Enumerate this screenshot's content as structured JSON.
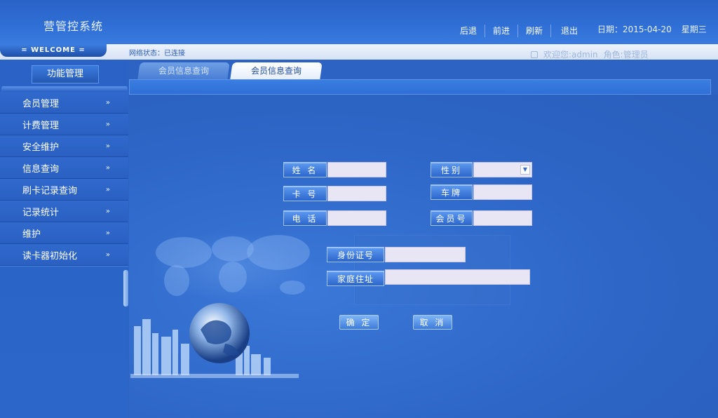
{
  "header": {
    "title": "营管控系统",
    "nav": {
      "back": "后退",
      "forward": "前进",
      "refresh": "刷新",
      "logout": "退出"
    },
    "date_label": "日期：2015-04-20",
    "weekday": "星期三"
  },
  "statusbar": {
    "welcome": "= WELCOME =",
    "network_status": "网络状态：已连接",
    "user": "欢迎您:admin",
    "role": "角色:管理员"
  },
  "sidebar": {
    "heading": "功能管理",
    "items": [
      {
        "label": "会员管理"
      },
      {
        "label": "计费管理"
      },
      {
        "label": "安全维护"
      },
      {
        "label": "信息查询"
      },
      {
        "label": "刷卡记录查询"
      },
      {
        "label": "记录统计"
      },
      {
        "label": "维护"
      },
      {
        "label": "读卡器初始化"
      }
    ],
    "chevron": "»"
  },
  "tabs": [
    {
      "label": "会员信息查询",
      "active": false
    },
    {
      "label": "会员信息查询",
      "active": true
    }
  ],
  "form": {
    "name_label": "姓 名",
    "gender_label": "性别",
    "card_label": "卡 号",
    "plate_label": "车牌",
    "phone_label": "电 话",
    "member_no_label": "会员号",
    "id_label": "身份证号",
    "address_label": "家庭住址",
    "name_value": "",
    "gender_value": "",
    "card_value": "",
    "plate_value": "",
    "phone_value": "",
    "member_no_value": "",
    "id_value": "",
    "address_value": ""
  },
  "buttons": {
    "confirm": "确 定",
    "cancel": "取 消"
  },
  "colors": {
    "primary": "#2d63c2",
    "accent": "#5d9af0",
    "input_bg": "#e8e6f4"
  },
  "icons": {
    "select_arrow": "chevron-down-icon",
    "menu_chevron": "double-chevron-down-icon"
  }
}
